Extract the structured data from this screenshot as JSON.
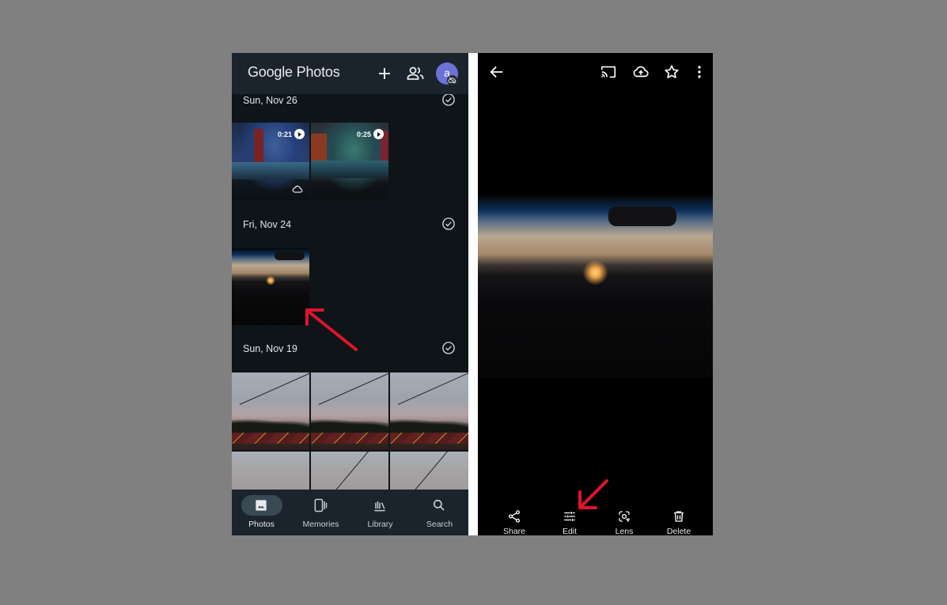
{
  "left_panel": {
    "app_title": {
      "google": "Google",
      "photos": "Photos"
    },
    "header_icons": [
      "add-icon",
      "shared-people-icon"
    ],
    "avatar": {
      "letter": "a",
      "color": "#6d72d6",
      "badge": "cloud-off-icon"
    },
    "sections": [
      {
        "date": "Sun, Nov 26",
        "items": [
          {
            "type": "video",
            "duration": "0:21",
            "badge": "cloud-icon"
          },
          {
            "type": "video",
            "duration": "0:25"
          }
        ]
      },
      {
        "date": "Fri, Nov 24",
        "items": [
          {
            "type": "photo",
            "description": "sunset through car windshield"
          }
        ]
      },
      {
        "date": "Sun, Nov 19",
        "items": [
          {
            "type": "photo",
            "description": "evening sky with string lights"
          },
          {
            "type": "photo",
            "description": "evening sky with string lights"
          },
          {
            "type": "photo",
            "description": "evening sky with string lights"
          },
          {
            "type": "photo",
            "description": "sky"
          },
          {
            "type": "photo",
            "description": "sky"
          },
          {
            "type": "photo",
            "description": "sky"
          }
        ]
      }
    ],
    "bottom_nav": [
      {
        "label": "Photos",
        "icon": "photos-icon",
        "active": true
      },
      {
        "label": "Memories",
        "icon": "memories-icon",
        "active": false
      },
      {
        "label": "Library",
        "icon": "library-icon",
        "active": false
      },
      {
        "label": "Search",
        "icon": "search-icon",
        "active": false
      }
    ]
  },
  "right_panel": {
    "top_actions": [
      "back-arrow-icon",
      "cast-icon",
      "cloud-upload-icon",
      "star-icon",
      "more-vert-icon"
    ],
    "photo_description": "sunset through car windshield",
    "bottom_actions": [
      {
        "label": "Share",
        "icon": "share-icon"
      },
      {
        "label": "Edit",
        "icon": "edit-sliders-icon"
      },
      {
        "label": "Lens",
        "icon": "lens-icon"
      },
      {
        "label": "Delete",
        "icon": "trash-icon"
      }
    ]
  },
  "annotations": {
    "arrow_color": "#e0142b",
    "arrows": [
      "pointing to Fri, Nov 24 photo thumbnail",
      "pointing to Edit button"
    ]
  }
}
